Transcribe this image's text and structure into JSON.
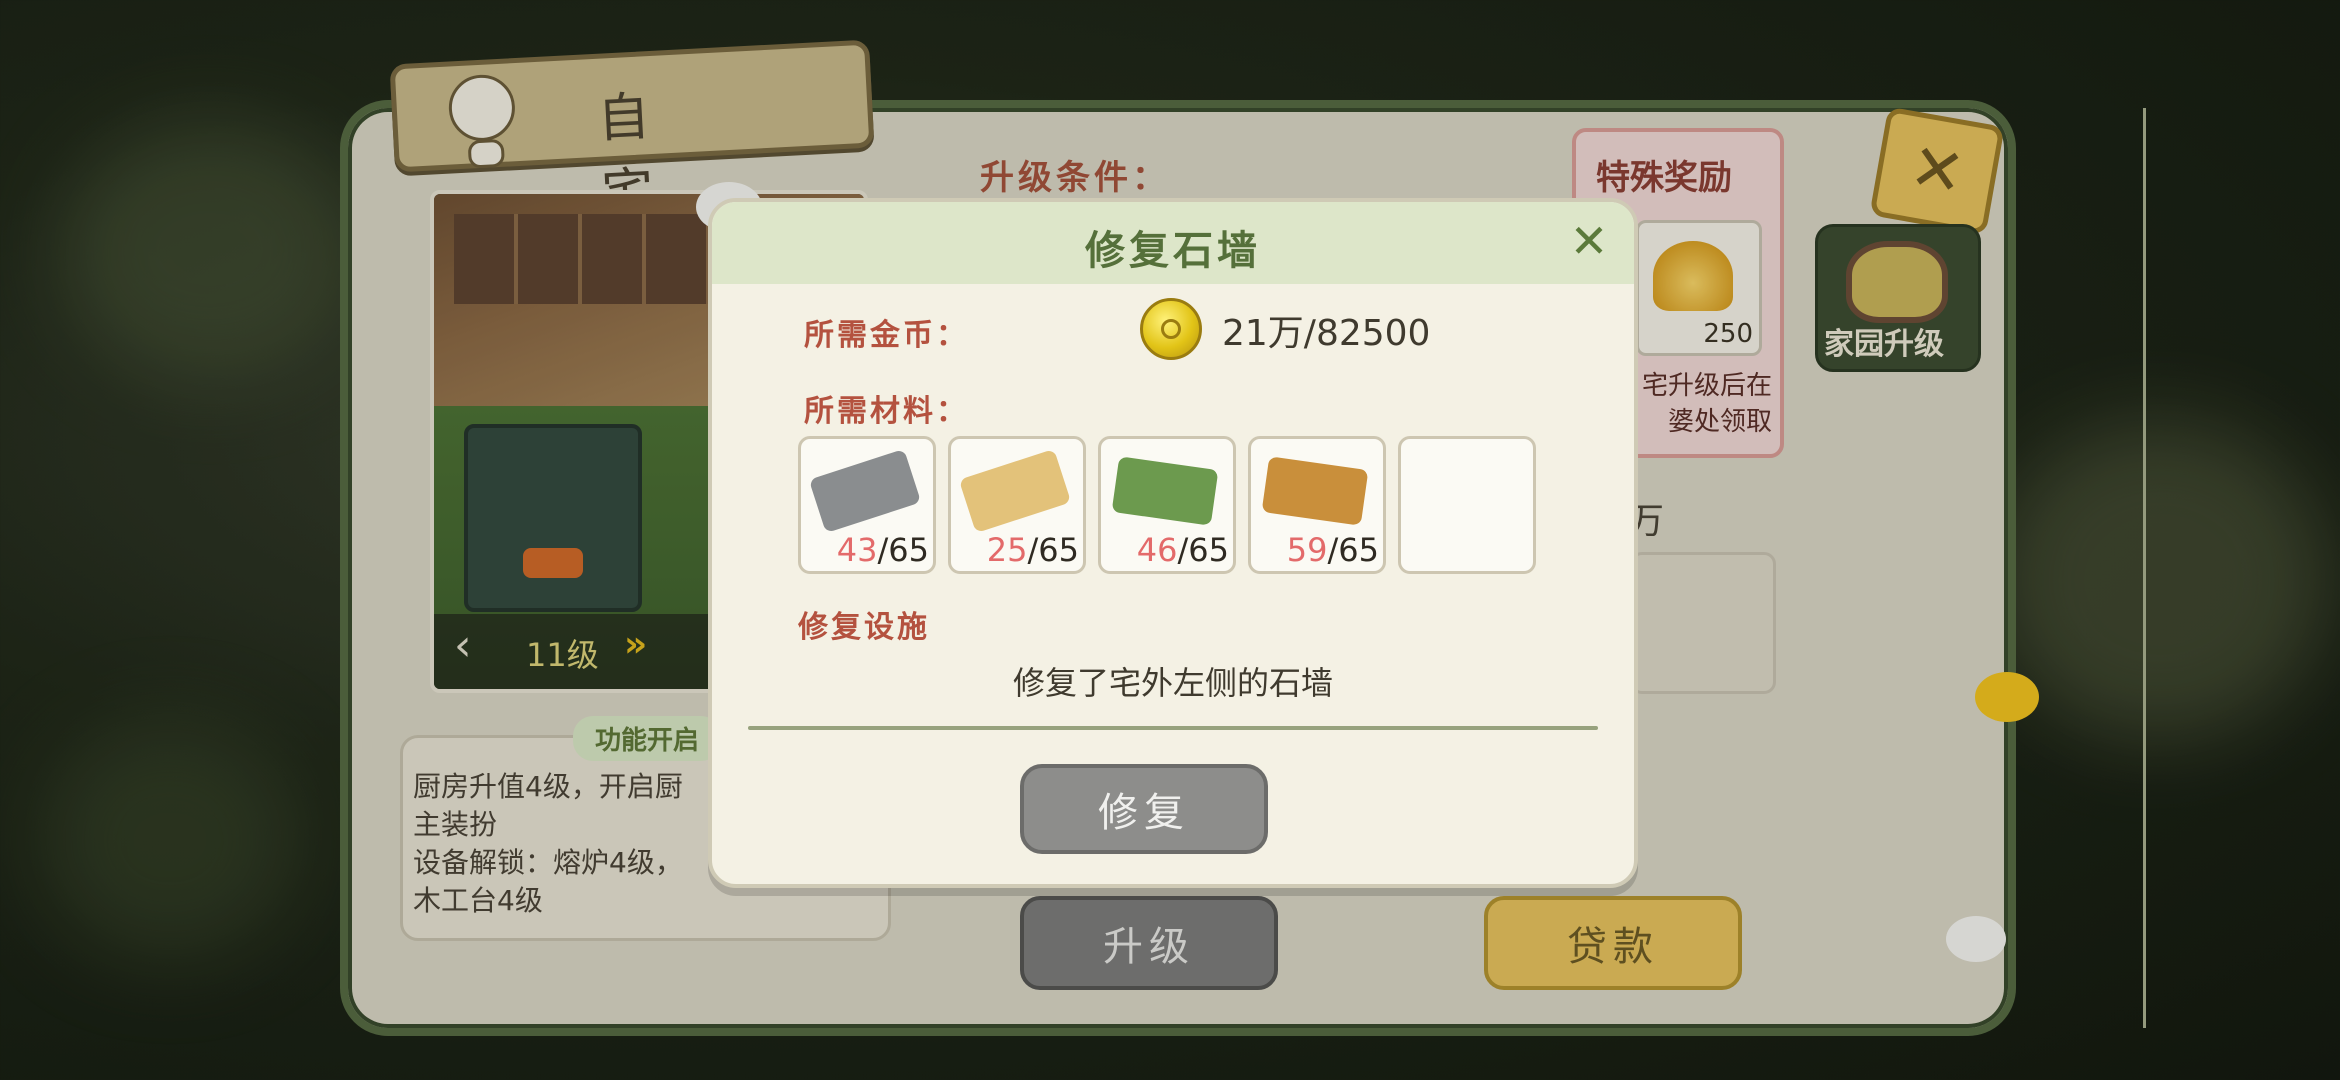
{
  "screen": {
    "panel_title": "自 宅",
    "preview": {
      "level": "11级",
      "prev_arrow": "‹",
      "next_arrow": "»"
    },
    "feature": {
      "title": "功能开启",
      "lines": [
        "厨房升值4级，开启厨",
        "主装扮",
        "设备解锁：熔炉4级，",
        "木工台4级"
      ]
    },
    "upgrade_conditions_label": "升级条件：",
    "special_reward": {
      "title": "特殊奖励",
      "count": "250",
      "desc_line1": "宅升级后在",
      "desc_line2": "婆处领取"
    },
    "partial_text": "万",
    "buttons": {
      "upgrade": "升级",
      "loan": "贷款"
    },
    "home_upgrade_label": "家园升级"
  },
  "modal": {
    "title": "修复石墙",
    "coin_label": "所需金币：",
    "coin_value": "21万/82500",
    "materials_label": "所需材料：",
    "materials": [
      {
        "name": "dark-wood",
        "have": "43",
        "need": "/65",
        "color": "#8a8d8f"
      },
      {
        "name": "light-wood",
        "have": "25",
        "need": "/65",
        "color": "#e3c27a"
      },
      {
        "name": "green-ingot",
        "have": "46",
        "need": "/65",
        "color": "#6c9a4e"
      },
      {
        "name": "bronze-ingot",
        "have": "59",
        "need": "/65",
        "color": "#c98f3b"
      }
    ],
    "facility_label": "修复设施",
    "facility_desc": "修复了宅外左侧的石墙",
    "repair_button": "修复"
  }
}
